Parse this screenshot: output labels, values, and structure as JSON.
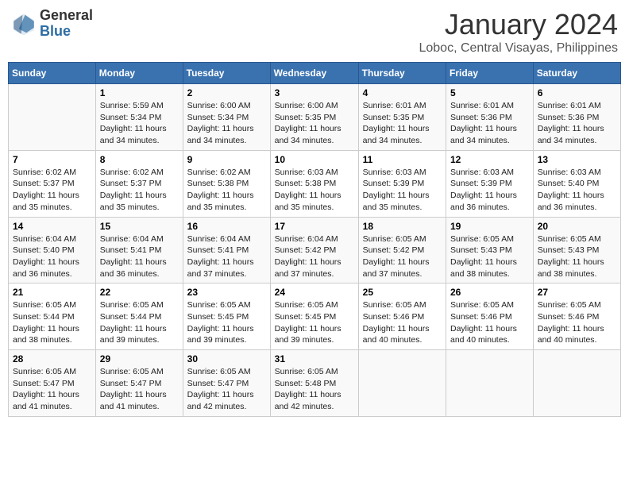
{
  "header": {
    "logo_general": "General",
    "logo_blue": "Blue",
    "month": "January 2024",
    "location": "Loboc, Central Visayas, Philippines"
  },
  "days_of_week": [
    "Sunday",
    "Monday",
    "Tuesday",
    "Wednesday",
    "Thursday",
    "Friday",
    "Saturday"
  ],
  "weeks": [
    [
      {
        "day": "",
        "info": ""
      },
      {
        "day": "1",
        "info": "Sunrise: 5:59 AM\nSunset: 5:34 PM\nDaylight: 11 hours\nand 34 minutes."
      },
      {
        "day": "2",
        "info": "Sunrise: 6:00 AM\nSunset: 5:34 PM\nDaylight: 11 hours\nand 34 minutes."
      },
      {
        "day": "3",
        "info": "Sunrise: 6:00 AM\nSunset: 5:35 PM\nDaylight: 11 hours\nand 34 minutes."
      },
      {
        "day": "4",
        "info": "Sunrise: 6:01 AM\nSunset: 5:35 PM\nDaylight: 11 hours\nand 34 minutes."
      },
      {
        "day": "5",
        "info": "Sunrise: 6:01 AM\nSunset: 5:36 PM\nDaylight: 11 hours\nand 34 minutes."
      },
      {
        "day": "6",
        "info": "Sunrise: 6:01 AM\nSunset: 5:36 PM\nDaylight: 11 hours\nand 34 minutes."
      }
    ],
    [
      {
        "day": "7",
        "info": "Sunrise: 6:02 AM\nSunset: 5:37 PM\nDaylight: 11 hours\nand 35 minutes."
      },
      {
        "day": "8",
        "info": "Sunrise: 6:02 AM\nSunset: 5:37 PM\nDaylight: 11 hours\nand 35 minutes."
      },
      {
        "day": "9",
        "info": "Sunrise: 6:02 AM\nSunset: 5:38 PM\nDaylight: 11 hours\nand 35 minutes."
      },
      {
        "day": "10",
        "info": "Sunrise: 6:03 AM\nSunset: 5:38 PM\nDaylight: 11 hours\nand 35 minutes."
      },
      {
        "day": "11",
        "info": "Sunrise: 6:03 AM\nSunset: 5:39 PM\nDaylight: 11 hours\nand 35 minutes."
      },
      {
        "day": "12",
        "info": "Sunrise: 6:03 AM\nSunset: 5:39 PM\nDaylight: 11 hours\nand 36 minutes."
      },
      {
        "day": "13",
        "info": "Sunrise: 6:03 AM\nSunset: 5:40 PM\nDaylight: 11 hours\nand 36 minutes."
      }
    ],
    [
      {
        "day": "14",
        "info": "Sunrise: 6:04 AM\nSunset: 5:40 PM\nDaylight: 11 hours\nand 36 minutes."
      },
      {
        "day": "15",
        "info": "Sunrise: 6:04 AM\nSunset: 5:41 PM\nDaylight: 11 hours\nand 36 minutes."
      },
      {
        "day": "16",
        "info": "Sunrise: 6:04 AM\nSunset: 5:41 PM\nDaylight: 11 hours\nand 37 minutes."
      },
      {
        "day": "17",
        "info": "Sunrise: 6:04 AM\nSunset: 5:42 PM\nDaylight: 11 hours\nand 37 minutes."
      },
      {
        "day": "18",
        "info": "Sunrise: 6:05 AM\nSunset: 5:42 PM\nDaylight: 11 hours\nand 37 minutes."
      },
      {
        "day": "19",
        "info": "Sunrise: 6:05 AM\nSunset: 5:43 PM\nDaylight: 11 hours\nand 38 minutes."
      },
      {
        "day": "20",
        "info": "Sunrise: 6:05 AM\nSunset: 5:43 PM\nDaylight: 11 hours\nand 38 minutes."
      }
    ],
    [
      {
        "day": "21",
        "info": "Sunrise: 6:05 AM\nSunset: 5:44 PM\nDaylight: 11 hours\nand 38 minutes."
      },
      {
        "day": "22",
        "info": "Sunrise: 6:05 AM\nSunset: 5:44 PM\nDaylight: 11 hours\nand 39 minutes."
      },
      {
        "day": "23",
        "info": "Sunrise: 6:05 AM\nSunset: 5:45 PM\nDaylight: 11 hours\nand 39 minutes."
      },
      {
        "day": "24",
        "info": "Sunrise: 6:05 AM\nSunset: 5:45 PM\nDaylight: 11 hours\nand 39 minutes."
      },
      {
        "day": "25",
        "info": "Sunrise: 6:05 AM\nSunset: 5:46 PM\nDaylight: 11 hours\nand 40 minutes."
      },
      {
        "day": "26",
        "info": "Sunrise: 6:05 AM\nSunset: 5:46 PM\nDaylight: 11 hours\nand 40 minutes."
      },
      {
        "day": "27",
        "info": "Sunrise: 6:05 AM\nSunset: 5:46 PM\nDaylight: 11 hours\nand 40 minutes."
      }
    ],
    [
      {
        "day": "28",
        "info": "Sunrise: 6:05 AM\nSunset: 5:47 PM\nDaylight: 11 hours\nand 41 minutes."
      },
      {
        "day": "29",
        "info": "Sunrise: 6:05 AM\nSunset: 5:47 PM\nDaylight: 11 hours\nand 41 minutes."
      },
      {
        "day": "30",
        "info": "Sunrise: 6:05 AM\nSunset: 5:47 PM\nDaylight: 11 hours\nand 42 minutes."
      },
      {
        "day": "31",
        "info": "Sunrise: 6:05 AM\nSunset: 5:48 PM\nDaylight: 11 hours\nand 42 minutes."
      },
      {
        "day": "",
        "info": ""
      },
      {
        "day": "",
        "info": ""
      },
      {
        "day": "",
        "info": ""
      }
    ]
  ]
}
